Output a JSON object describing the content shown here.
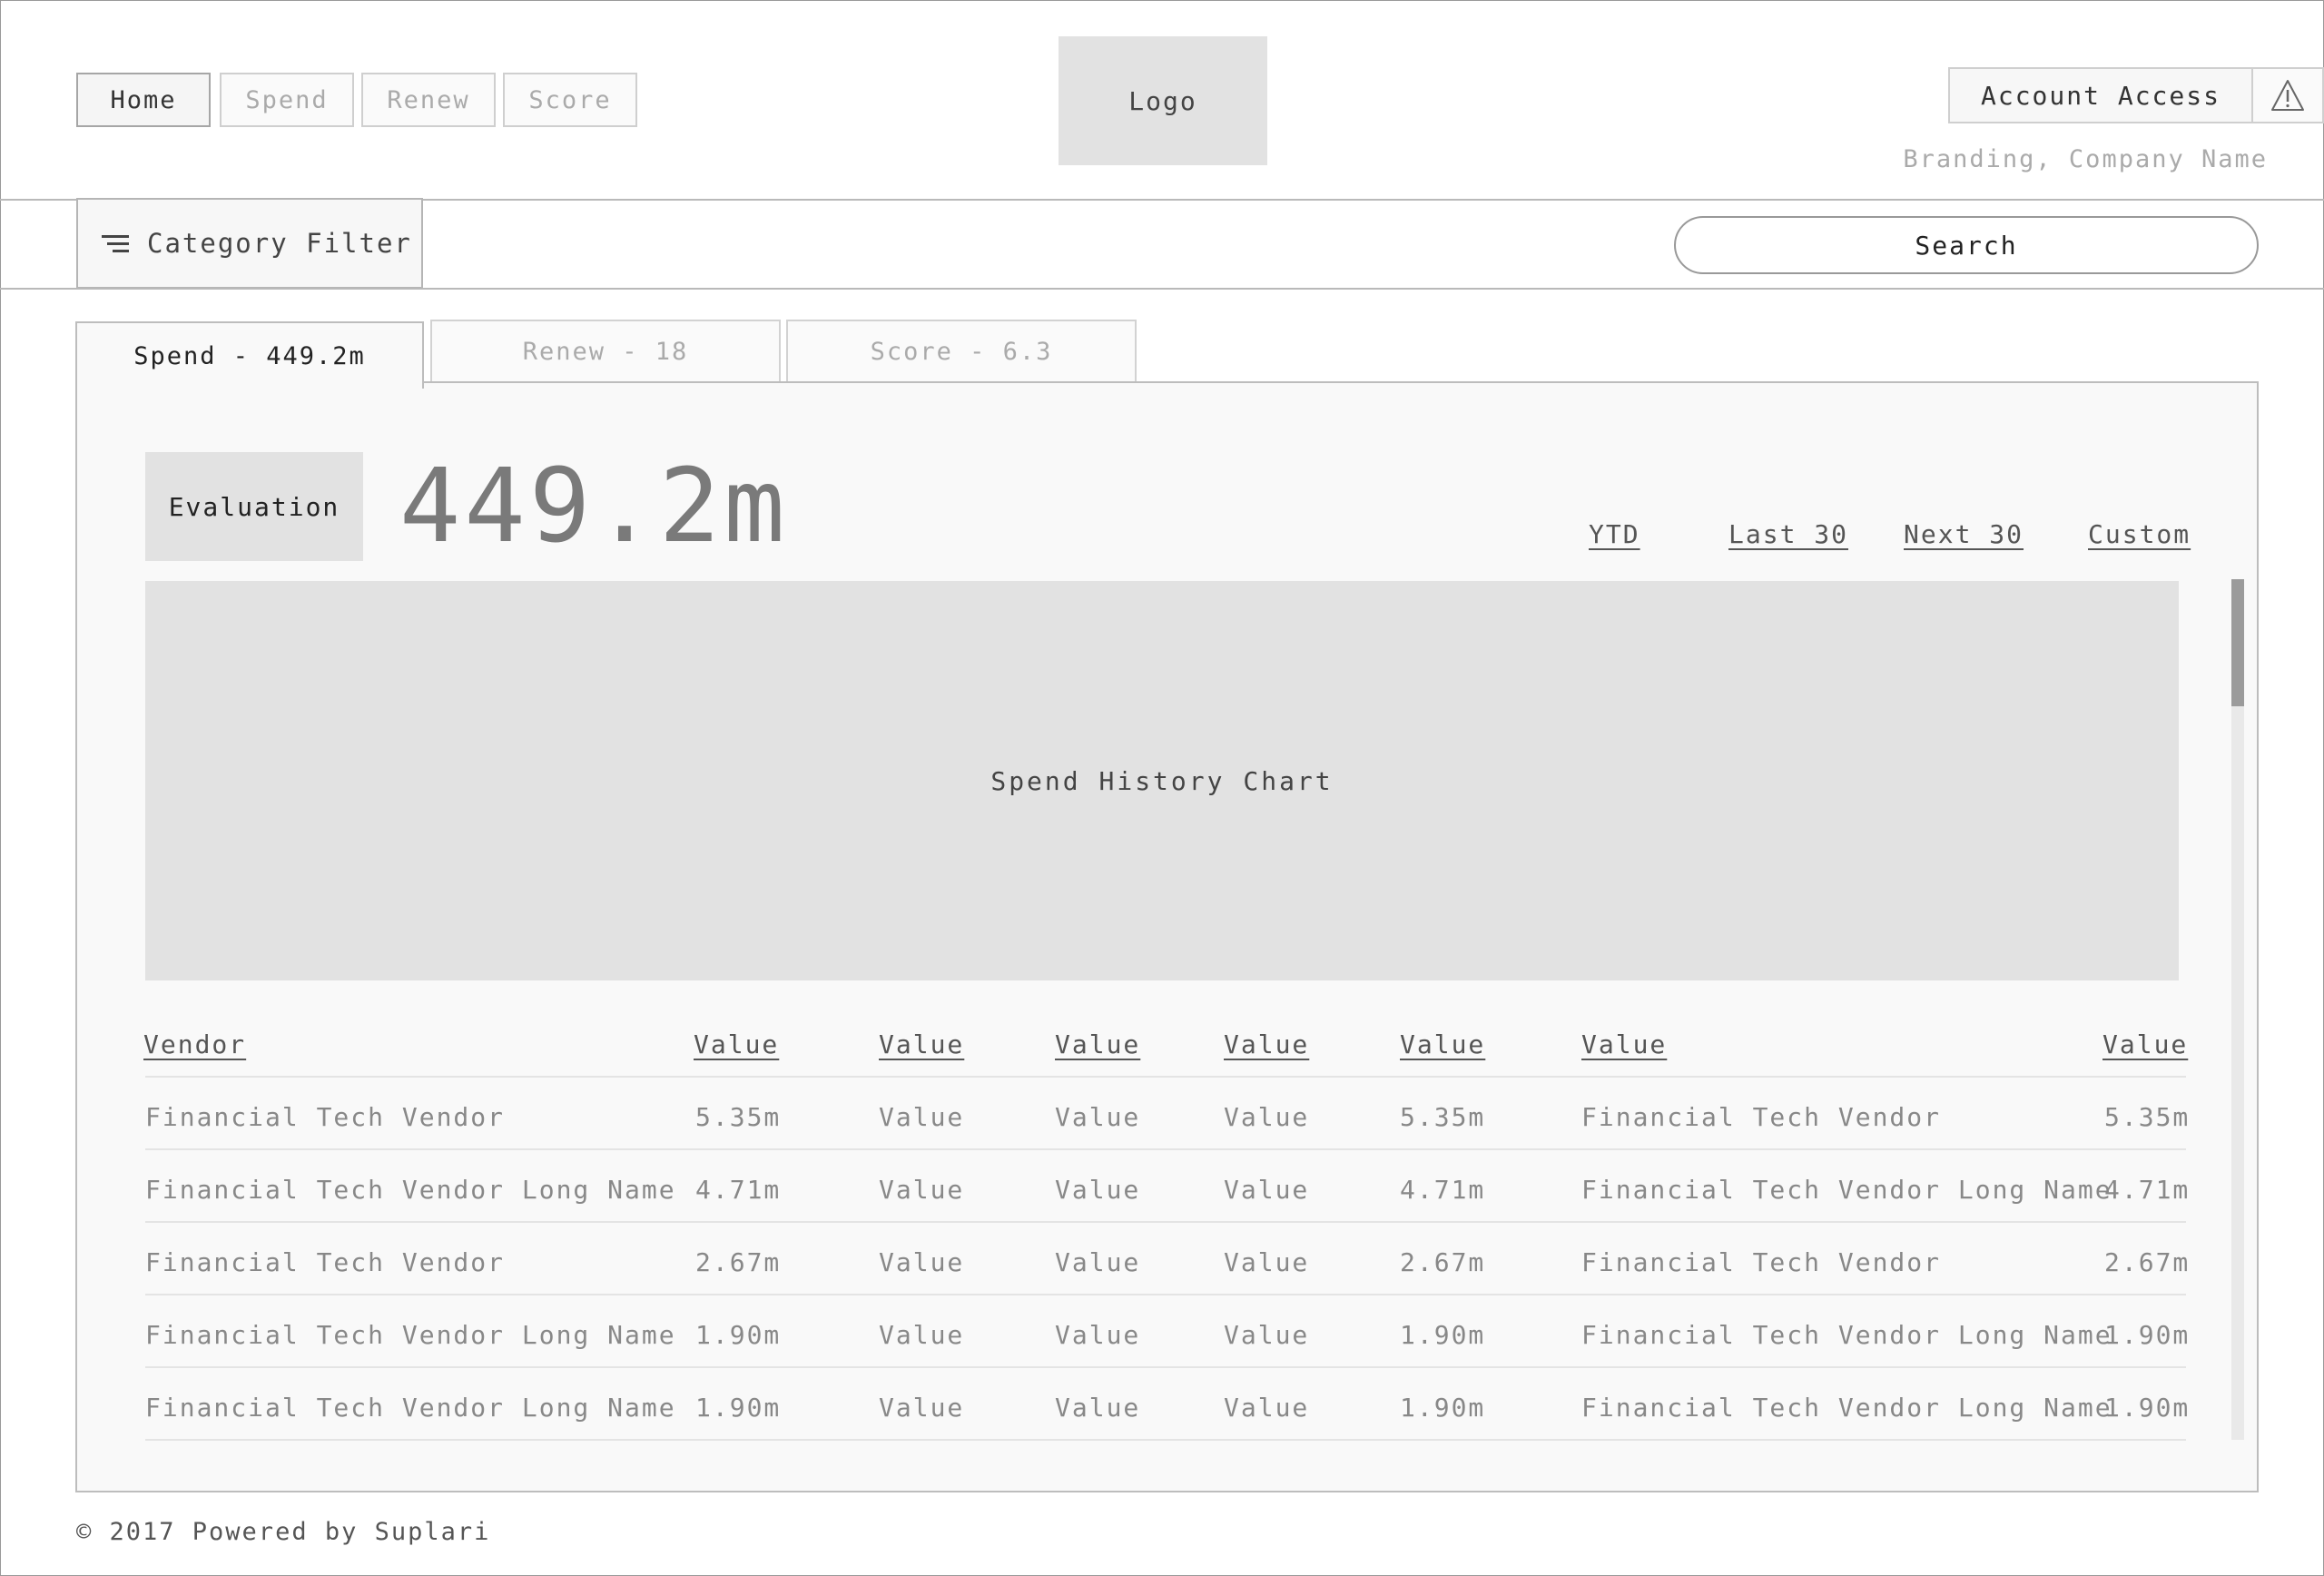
{
  "header": {
    "nav": [
      "Home",
      "Spend",
      "Renew",
      "Score"
    ],
    "logo": "Logo",
    "account_access": "Account Access",
    "branding": "Branding, Company Name"
  },
  "filter_bar": {
    "category_filter": "Category Filter",
    "search_placeholder": "Search"
  },
  "tabs": [
    "Spend - 449.2m",
    "Renew - 18",
    "Score - 6.3"
  ],
  "summary": {
    "evaluation_label": "Evaluation",
    "big_value": "449.2m",
    "periods": [
      "YTD",
      "Last 30",
      "Next 30",
      "Custom"
    ]
  },
  "chart_placeholder": "Spend History Chart",
  "table": {
    "headers": [
      "Vendor",
      "Value",
      "Value",
      "Value",
      "Value",
      "Value",
      "Value",
      "Value"
    ],
    "rows": [
      [
        "Financial Tech Vendor",
        "5.35m",
        "Value",
        "Value",
        "Value",
        "5.35m",
        "Financial Tech Vendor",
        "5.35m"
      ],
      [
        "Financial Tech Vendor Long Name",
        "4.71m",
        "Value",
        "Value",
        "Value",
        "4.71m",
        "Financial Tech Vendor Long Name",
        "4.71m"
      ],
      [
        "Financial Tech Vendor",
        "2.67m",
        "Value",
        "Value",
        "Value",
        "2.67m",
        "Financial Tech Vendor",
        "2.67m"
      ],
      [
        "Financial Tech Vendor Long Name",
        "1.90m",
        "Value",
        "Value",
        "Value",
        "1.90m",
        "Financial Tech Vendor Long Name",
        "1.90m"
      ],
      [
        "Financial Tech Vendor Long Name",
        "1.90m",
        "Value",
        "Value",
        "Value",
        "1.90m",
        "Financial Tech Vendor Long Name",
        "1.90m"
      ]
    ]
  },
  "footer": "© 2017 Powered by Suplari",
  "colors": {
    "panel_bg": "#f9f9f9",
    "placeholder_gray": "#e2e2e2",
    "border": "#bdbdbd",
    "muted_text": "#aaaaaa"
  },
  "icons": {
    "filter": "filter-lines-icon",
    "alert": "warning-triangle-icon"
  }
}
